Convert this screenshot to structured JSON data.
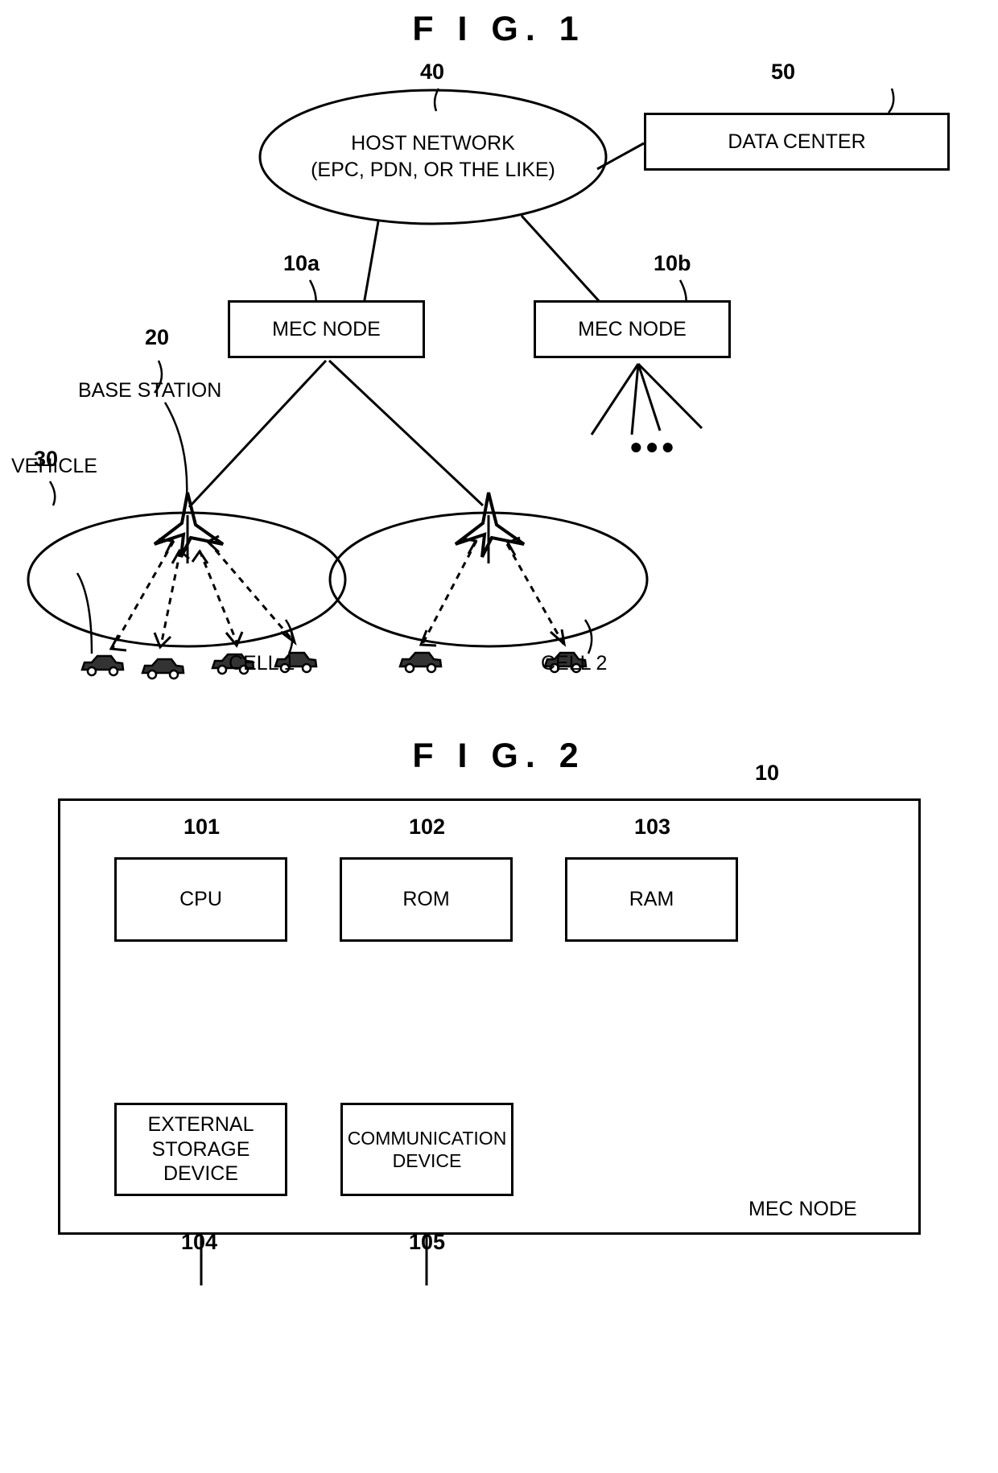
{
  "figures": [
    {
      "id": "fig1",
      "title": "F I G.  1",
      "nodes": {
        "host_network": {
          "line1": "HOST NETWORK",
          "line2": "(EPC, PDN, OR THE LIKE)",
          "ref": "40"
        },
        "data_center": {
          "label": "DATA CENTER",
          "ref": "50"
        },
        "mec_node_a": {
          "label": "MEC NODE",
          "ref": "10a"
        },
        "mec_node_b": {
          "label": "MEC NODE",
          "ref": "10b"
        },
        "base_station": {
          "label": "BASE STATION",
          "ref": "20"
        },
        "vehicle": {
          "label": "VEHICLE",
          "ref": "30"
        },
        "cell1": {
          "label": "CELL 1"
        },
        "cell2": {
          "label": "CELL 2"
        },
        "ellipsis": "•••"
      }
    },
    {
      "id": "fig2",
      "title": "F I G.  2",
      "outer": {
        "ref": "10",
        "label": "MEC NODE"
      },
      "blocks": [
        {
          "label": "CPU",
          "ref": "101"
        },
        {
          "label": "ROM",
          "ref": "102"
        },
        {
          "label": "RAM",
          "ref": "103"
        },
        {
          "label": "EXTERNAL\nSTORAGE\nDEVICE",
          "ref": "104"
        },
        {
          "label": "COMMUNICATION\nDEVICE",
          "ref": "105"
        }
      ]
    }
  ],
  "colors": {
    "ink": "#000000",
    "paper": "#ffffff"
  }
}
